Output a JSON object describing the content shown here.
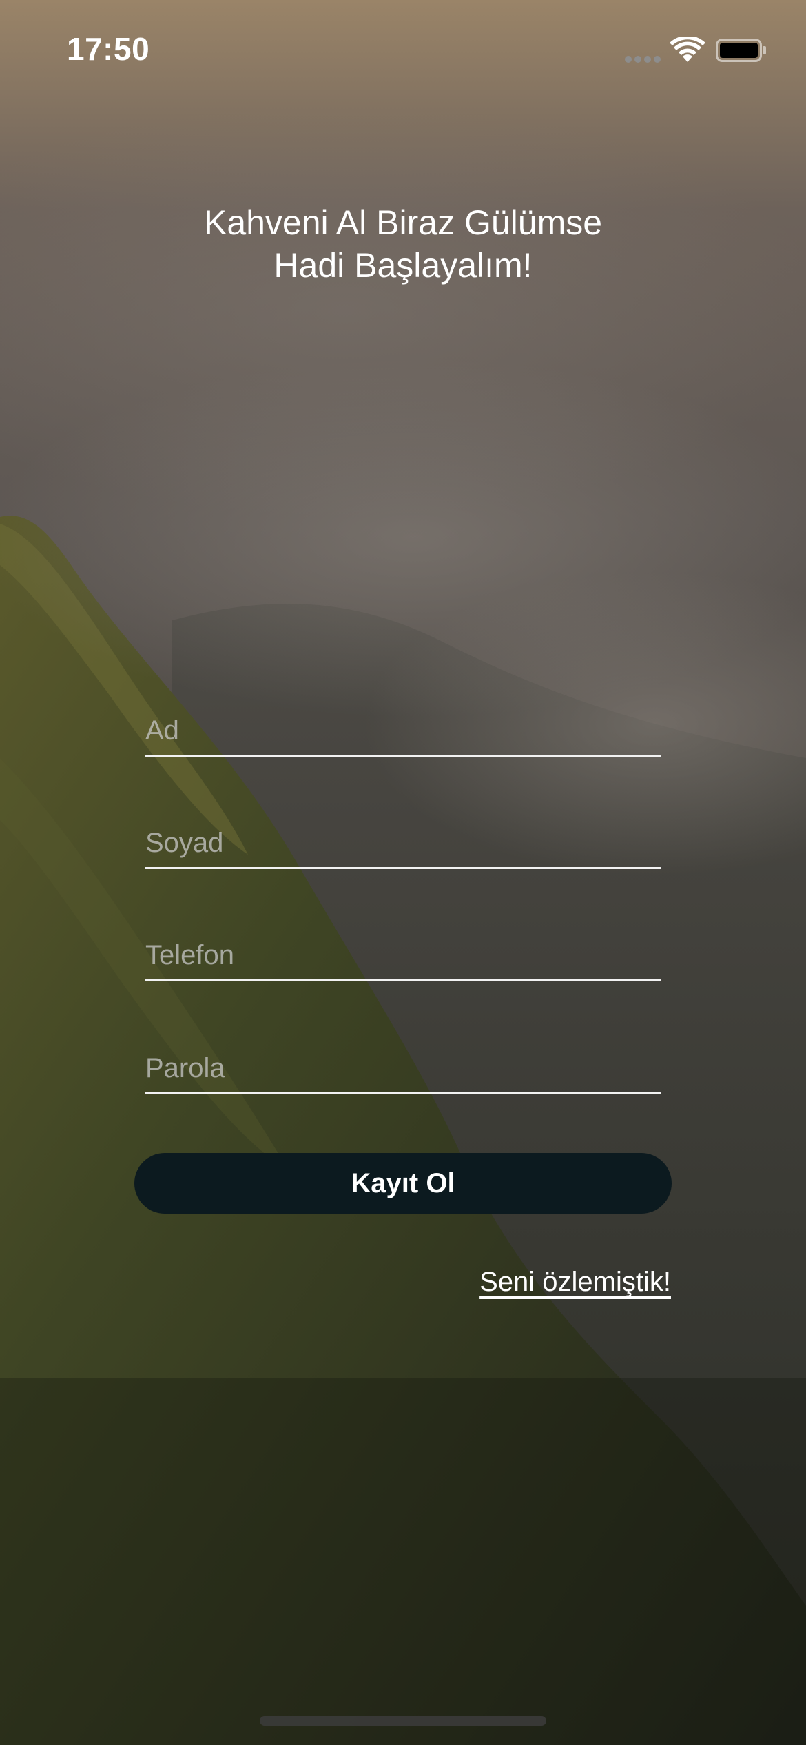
{
  "status_bar": {
    "time": "17:50",
    "signal_icon": "cellular-signal-icon",
    "wifi_icon": "wifi-icon",
    "battery_icon": "battery-icon"
  },
  "headline": {
    "line1": "Kahveni Al Biraz Gülümse",
    "line2": "Hadi Başlayalım!"
  },
  "form": {
    "first_name": {
      "placeholder": "Ad",
      "value": ""
    },
    "last_name": {
      "placeholder": "Soyad",
      "value": ""
    },
    "phone": {
      "placeholder": "Telefon",
      "value": ""
    },
    "password": {
      "placeholder": "Parola",
      "value": ""
    }
  },
  "register_button": {
    "label": "Kayıt Ol"
  },
  "login_link": {
    "label": "Seni özlemiştik!"
  },
  "colors": {
    "button_bg": "#0c1a1f",
    "text": "#ffffff",
    "field_underline": "#f2f2f2",
    "placeholder": "#c8c8c8"
  }
}
